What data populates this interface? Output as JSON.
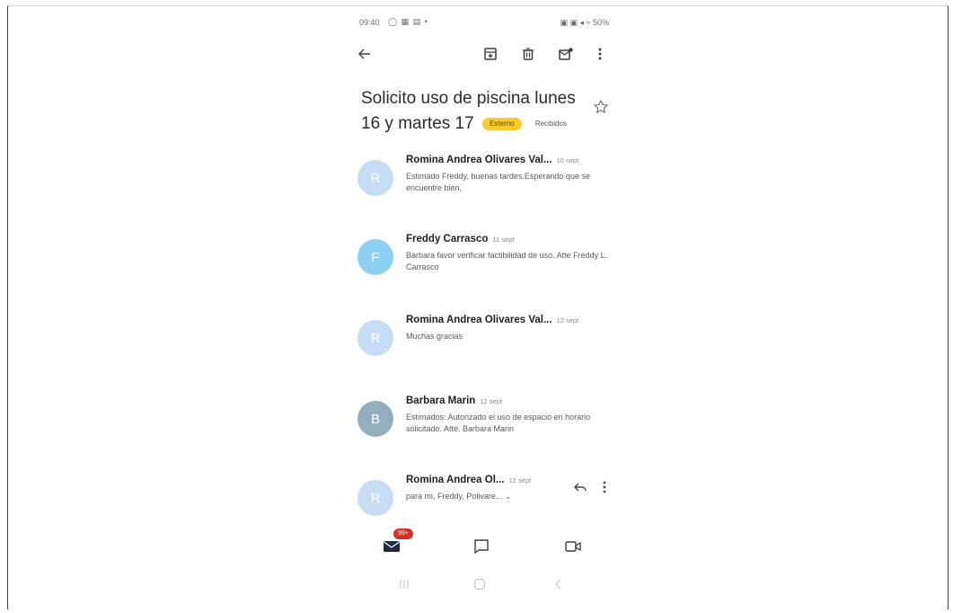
{
  "status_bar": {
    "time": "09:40",
    "apps": "◯ ▦ ▤ •",
    "right": "▣ ▣ ◂ ≈ 50%"
  },
  "email": {
    "subject": "Solicito uso de piscina lunes 16 y martes 17",
    "labels": [
      "Externo",
      "Recibidos"
    ],
    "messages": [
      {
        "initial": "R",
        "sender": "Romina Andrea Olivares Val...",
        "date": "10 sept",
        "snippet": "Estimado Freddy, buenas tardes.Esperando que se encuentre bien,",
        "avatar_color": "#c7dcf5"
      },
      {
        "initial": "F",
        "sender": "Freddy Carrasco",
        "date": "11 sept",
        "snippet": "Barbara favor verificar factibilidad de uso. Atte Freddy L. Carrasco",
        "avatar_color": "#8fd0f2"
      },
      {
        "initial": "R",
        "sender": "Romina Andrea Olivares Val...",
        "date": "12 sept",
        "snippet": "Muchas gracias",
        "avatar_color": "#c7dcf5"
      },
      {
        "initial": "B",
        "sender": "Barbara Marin",
        "date": "12 sept",
        "snippet": "Estimados: Autorizado el uso de espacio en horario solicitado. Atte. Barbara Marin",
        "avatar_color": "#93afbd"
      },
      {
        "initial": "R",
        "sender": "Romina Andrea Ol...",
        "date": "12 sept",
        "snippet": "para mi, Freddy, Polivare... ⌄",
        "avatar_color": "#c7dcf5"
      }
    ]
  },
  "bottom_nav": {
    "mail_badge": "99+"
  },
  "icons": {
    "back": "arrow-left-icon",
    "archive": "archive-icon",
    "delete": "trash-icon",
    "mark_unread": "mark-unread-icon",
    "more": "more-vertical-icon",
    "star": "star-outline-icon",
    "reply": "reply-icon",
    "mail": "mail-icon",
    "chat": "chat-icon",
    "meet": "video-icon"
  }
}
